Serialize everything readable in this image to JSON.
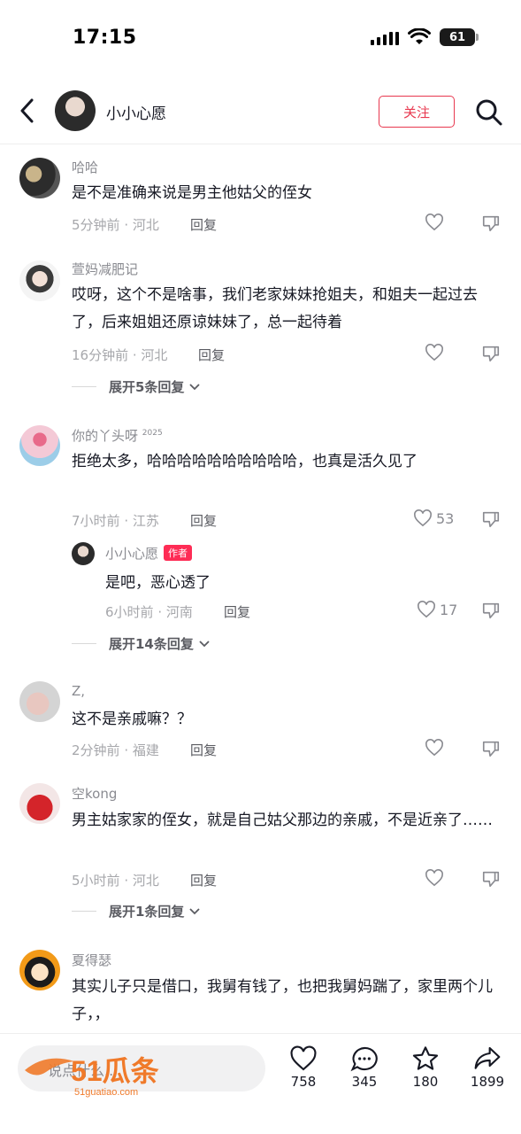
{
  "status_bar": {
    "time": "17:15",
    "battery": "61"
  },
  "header": {
    "username": "小小心愿",
    "follow_label": "关注"
  },
  "comments": [
    {
      "username": "哈哈",
      "text": "是不是准确来说是男主他姑父的侄女",
      "time": "5分钟前",
      "location": "河北",
      "reply_label": "回复"
    },
    {
      "username": "萱妈减肥记",
      "text": "哎呀，这个不是啥事，我们老家妹妹抢姐夫，和姐夫一起过去了，后来姐姐还原谅妹妹了，总一起待着",
      "time": "16分钟前",
      "location": "河北",
      "reply_label": "回复",
      "expand_label": "展开5条回复"
    },
    {
      "username": "你的丫头呀",
      "username_suffix": "2025",
      "text": "拒绝太多，哈哈哈哈哈哈哈哈哈哈，也真是活久见了",
      "time": "7小时前",
      "location": "江苏",
      "reply_label": "回复",
      "likes": "53",
      "reply": {
        "username": "小小心愿",
        "badge": "作者",
        "text": "是吧，恶心透了",
        "time": "6小时前",
        "location": "河南",
        "reply_label": "回复",
        "likes": "17"
      },
      "expand_label": "展开14条回复"
    },
    {
      "username": "Z,",
      "text": "这不是亲戚嘛？？",
      "time": "2分钟前",
      "location": "福建",
      "reply_label": "回复"
    },
    {
      "username": "空kong",
      "text": "男主姑家家的侄女，就是自己姑父那边的亲戚，不是近亲了……",
      "time": "5小时前",
      "location": "河北",
      "reply_label": "回复",
      "expand_label": "展开1条回复"
    },
    {
      "username": "夏得瑟",
      "text": "其实儿子只是借口，我舅有钱了，也把我舅妈踹了，家里两个儿子，，"
    }
  ],
  "bottom_bar": {
    "input_placeholder": "说点什么...",
    "likes": "758",
    "comments": "345",
    "favorites": "180",
    "shares": "1899"
  },
  "watermark": {
    "text": "51瓜条",
    "url": "51guatiao.com"
  },
  "colors": {
    "accent": "#fe2c55",
    "follow": "#e8384f",
    "watermark": "#f07a2a"
  }
}
